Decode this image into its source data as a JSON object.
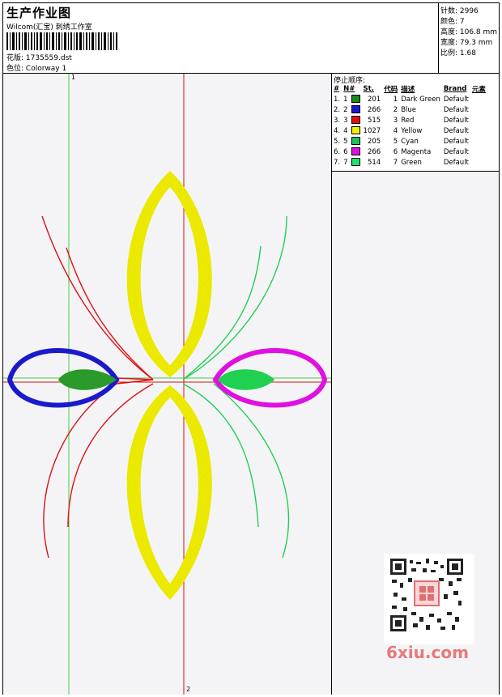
{
  "header": {
    "title": "生产作业图",
    "company": "Wilcom(汇宝) 刺绣工作室",
    "file_label": "花版:",
    "file_value": "1735559.dst",
    "colorway_label": "色位:",
    "colorway_value": "Colorway 1"
  },
  "stats": {
    "stitches": "针数: 2996",
    "colors": "颜色: 7",
    "height": "高度: 106.8 mm",
    "width": "宽度: 79.3 mm",
    "ratio": "比例: 1.68"
  },
  "sequence": {
    "title": "停止顺序:",
    "headers": [
      "#",
      "N#",
      "St.",
      "代码",
      "描述",
      "Brand",
      "元素"
    ],
    "rows": [
      {
        "idx": "1.",
        "n": "1",
        "color": "#1a8a1a",
        "st": "201",
        "code": "1",
        "desc": "Dark Green",
        "brand": "Default"
      },
      {
        "idx": "2.",
        "n": "2",
        "color": "#1a1acc",
        "st": "266",
        "code": "2",
        "desc": "Blue",
        "brand": "Default"
      },
      {
        "idx": "3.",
        "n": "3",
        "color": "#e01010",
        "st": "515",
        "code": "3",
        "desc": "Red",
        "brand": "Default"
      },
      {
        "idx": "4.",
        "n": "4",
        "color": "#f0f000",
        "st": "1027",
        "code": "4",
        "desc": "Yellow",
        "brand": "Default"
      },
      {
        "idx": "5.",
        "n": "5",
        "color": "#20c060",
        "st": "205",
        "code": "5",
        "desc": "Cyan",
        "brand": "Default"
      },
      {
        "idx": "6.",
        "n": "6",
        "color": "#e010e0",
        "st": "266",
        "code": "6",
        "desc": "Magenta",
        "brand": "Default"
      },
      {
        "idx": "7.",
        "n": "7",
        "color": "#20e070",
        "st": "514",
        "code": "7",
        "desc": "Green",
        "brand": "Default"
      }
    ]
  },
  "guides": {
    "vertical_label": "1",
    "bottom_label": "2"
  },
  "watermark": "6xiu.com",
  "colors": {
    "yellow": "#f2f000",
    "red": "#e01010",
    "green": "#20d050",
    "blue": "#1a1acc",
    "magenta": "#e010e0",
    "darkgreen": "#2a9a2a",
    "guide_green": "#40d040",
    "guide_red": "#e01010"
  }
}
